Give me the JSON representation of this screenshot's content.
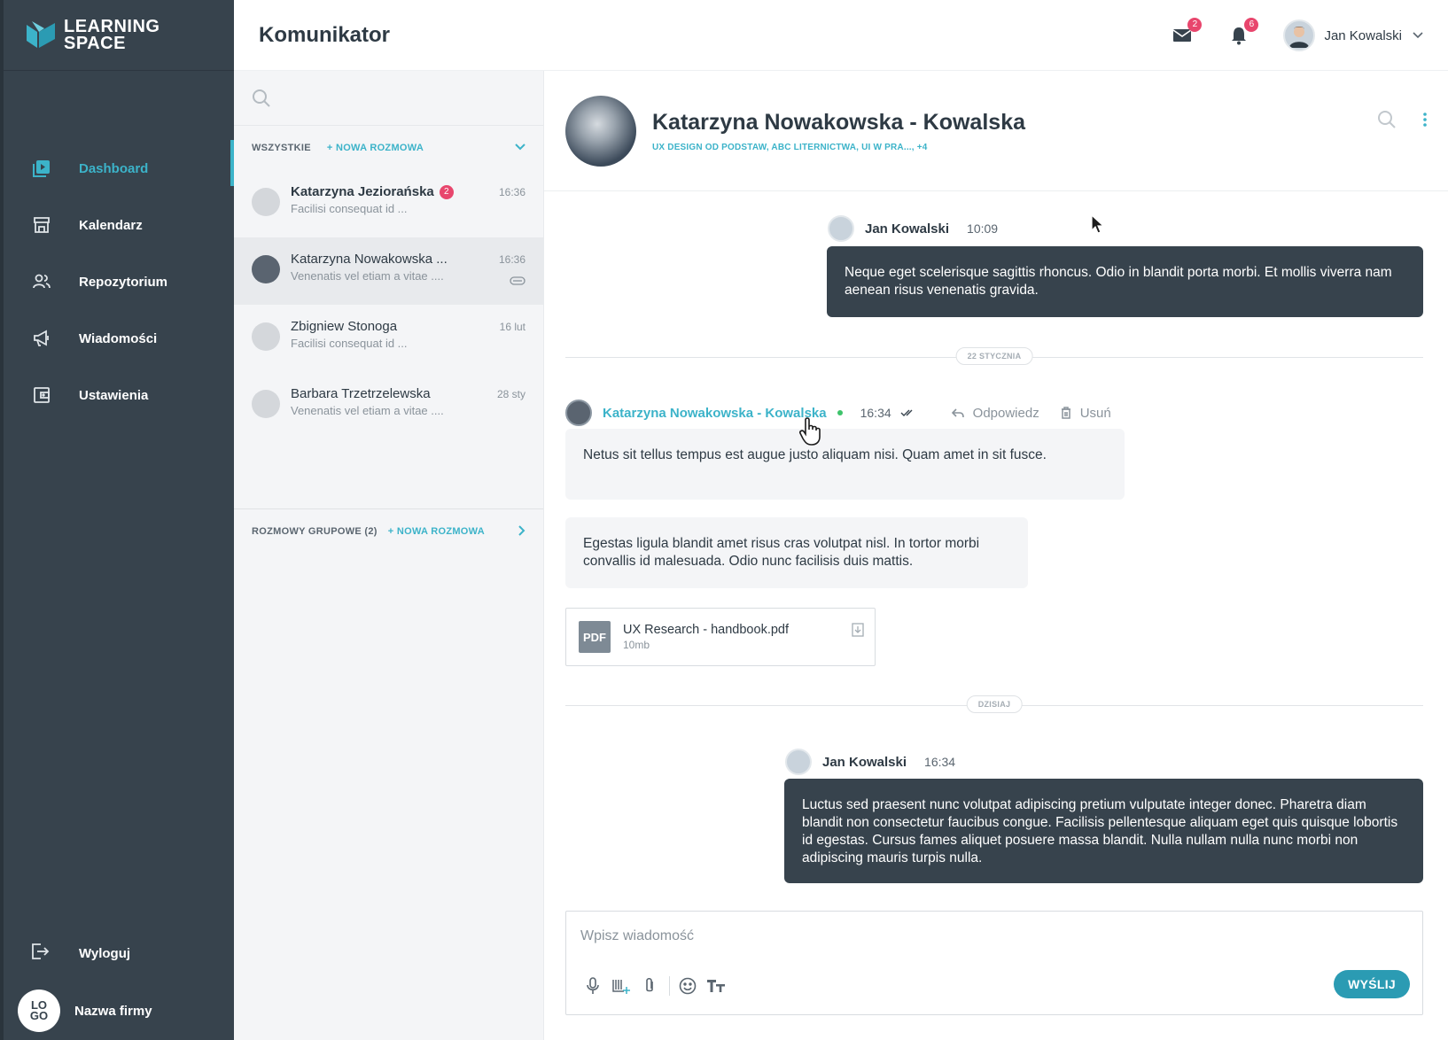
{
  "brand": {
    "line1": "LEARNING",
    "line2": "SPACE"
  },
  "nav": [
    {
      "label": "Dashboard",
      "icon": "play-square-icon",
      "active": true
    },
    {
      "label": "Kalendarz",
      "icon": "store-icon"
    },
    {
      "label": "Repozytorium",
      "icon": "users-icon"
    },
    {
      "label": "Wiadomości",
      "icon": "megaphone-icon"
    },
    {
      "label": "Ustawienia",
      "icon": "wallet-icon"
    }
  ],
  "logout_label": "Wyloguj",
  "company": {
    "logo": "LO GO",
    "name": "Nazwa firmy"
  },
  "header": {
    "title": "Komunikator",
    "mail_count": "2",
    "notif_count": "6",
    "user_name": "Jan Kowalski"
  },
  "convlist": {
    "all_label": "WSZYSTKIE",
    "new_conv": "+ NOWA ROZMOWA",
    "items": [
      {
        "name": "Katarzyna Jeziorańska",
        "unread": "2",
        "snippet": "Facilisi consequat id ...",
        "time": "16:36"
      },
      {
        "name": "Katarzyna Nowakowska ...",
        "snippet": "Venenatis vel etiam a vitae ....",
        "time": "16:36"
      },
      {
        "name": "Zbigniew Stonoga",
        "snippet": "Facilisi consequat id ...",
        "time": "16 lut"
      },
      {
        "name": "Barbara Trzetrzelewska",
        "snippet": "Venenatis vel etiam a vitae ....",
        "time": "28 sty"
      }
    ],
    "group_label": "ROZMOWY GRUPOWE (2)",
    "group_new": "+ NOWA ROZMOWA"
  },
  "chat": {
    "peer_name": "Katarzyna Nowakowska - Kowalska",
    "peer_courses": "UX DESIGN OD PODSTAW, ABC LITERNICTWA, UI W PRA..., +4",
    "messages": {
      "m1": {
        "author": "Jan Kowalski",
        "time": "10:09",
        "text": "Neque eget scelerisque sagittis rhoncus. Odio in blandit porta morbi. Et mollis viverra nam aenean risus venenatis gravida."
      },
      "divider1": "22 STYCZNIA",
      "m2": {
        "author": "Katarzyna Nowakowska - Kowalska",
        "time": "16:34",
        "reply": "Odpowiedz",
        "delete": "Usuń",
        "text1": "Netus sit tellus tempus est augue justo aliquam nisi. Quam amet in sit fusce.",
        "text2": "Egestas ligula blandit amet risus cras volutpat nisl. In tortor morbi convallis id malesuada. Odio nunc facilisis duis mattis."
      },
      "file": {
        "type": "PDF",
        "name": "UX Research - handbook.pdf",
        "size": "10mb"
      },
      "divider2": "DZISIAJ",
      "m3": {
        "author": "Jan Kowalski",
        "time": "16:34",
        "text": "Luctus sed praesent nunc volutpat adipiscing pretium vulputate integer donec. Pharetra diam blandit non consectetur faucibus congue. Facilisis pellentesque aliquam eget quis quisque lobortis id egestas. Cursus fames aliquet posuere massa blandit. Nulla nullam nulla nunc morbi non adipiscing mauris turpis nulla."
      }
    },
    "composer": {
      "placeholder": "Wpisz wiadomość",
      "send": "WYŚLIJ"
    }
  },
  "colors": {
    "accent": "#3cb3c9",
    "sidebar": "#37434d",
    "badge": "#e8466d",
    "online": "#3ec36b"
  }
}
